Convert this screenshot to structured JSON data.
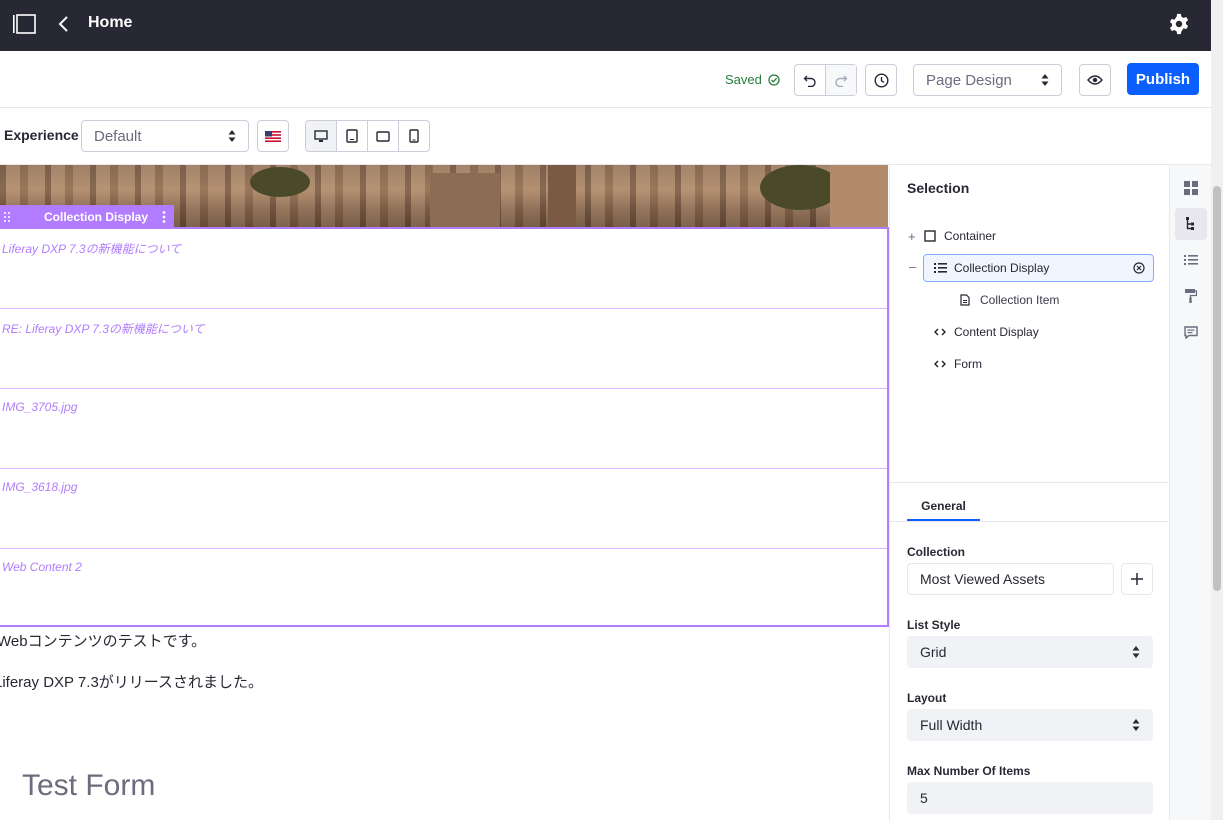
{
  "topbar": {
    "title": "Home",
    "icons": [
      "sidebar-toggle-icon",
      "chevron-left-icon",
      "gear-icon"
    ]
  },
  "toolbar": {
    "saved_label": "Saved",
    "page_design_label": "Page Design",
    "publish_label": "Publish"
  },
  "experience": {
    "label": "Experience",
    "selected": "Default"
  },
  "canvas": {
    "collection_tag": "Collection Display",
    "items": [
      "Liferay DXP 7.3の新機能について",
      "RE: Liferay DXP 7.3の新機能について",
      "IMG_3705.jpg",
      "IMG_3618.jpg",
      "Web Content 2"
    ],
    "text1": "Webコンテンツのテストです。",
    "text2": "Liferay DXP 7.3がリリースされました。",
    "form_title": "Test Form"
  },
  "panel": {
    "title": "Selection",
    "tree": {
      "container": "Container",
      "collection_display": "Collection Display",
      "collection_item": "Collection Item",
      "content_display": "Content Display",
      "form": "Form"
    },
    "tab_general": "General",
    "collection_label": "Collection",
    "collection_value": "Most Viewed Assets",
    "list_style_label": "List Style",
    "list_style_value": "Grid",
    "layout_label": "Layout",
    "layout_value": "Full Width",
    "max_items_label": "Max Number Of Items",
    "max_items_value": "5"
  },
  "colors": {
    "accent": "#0b5fff",
    "topbar": "#272833",
    "collection": "#b17cff",
    "saved": "#287d3c"
  }
}
